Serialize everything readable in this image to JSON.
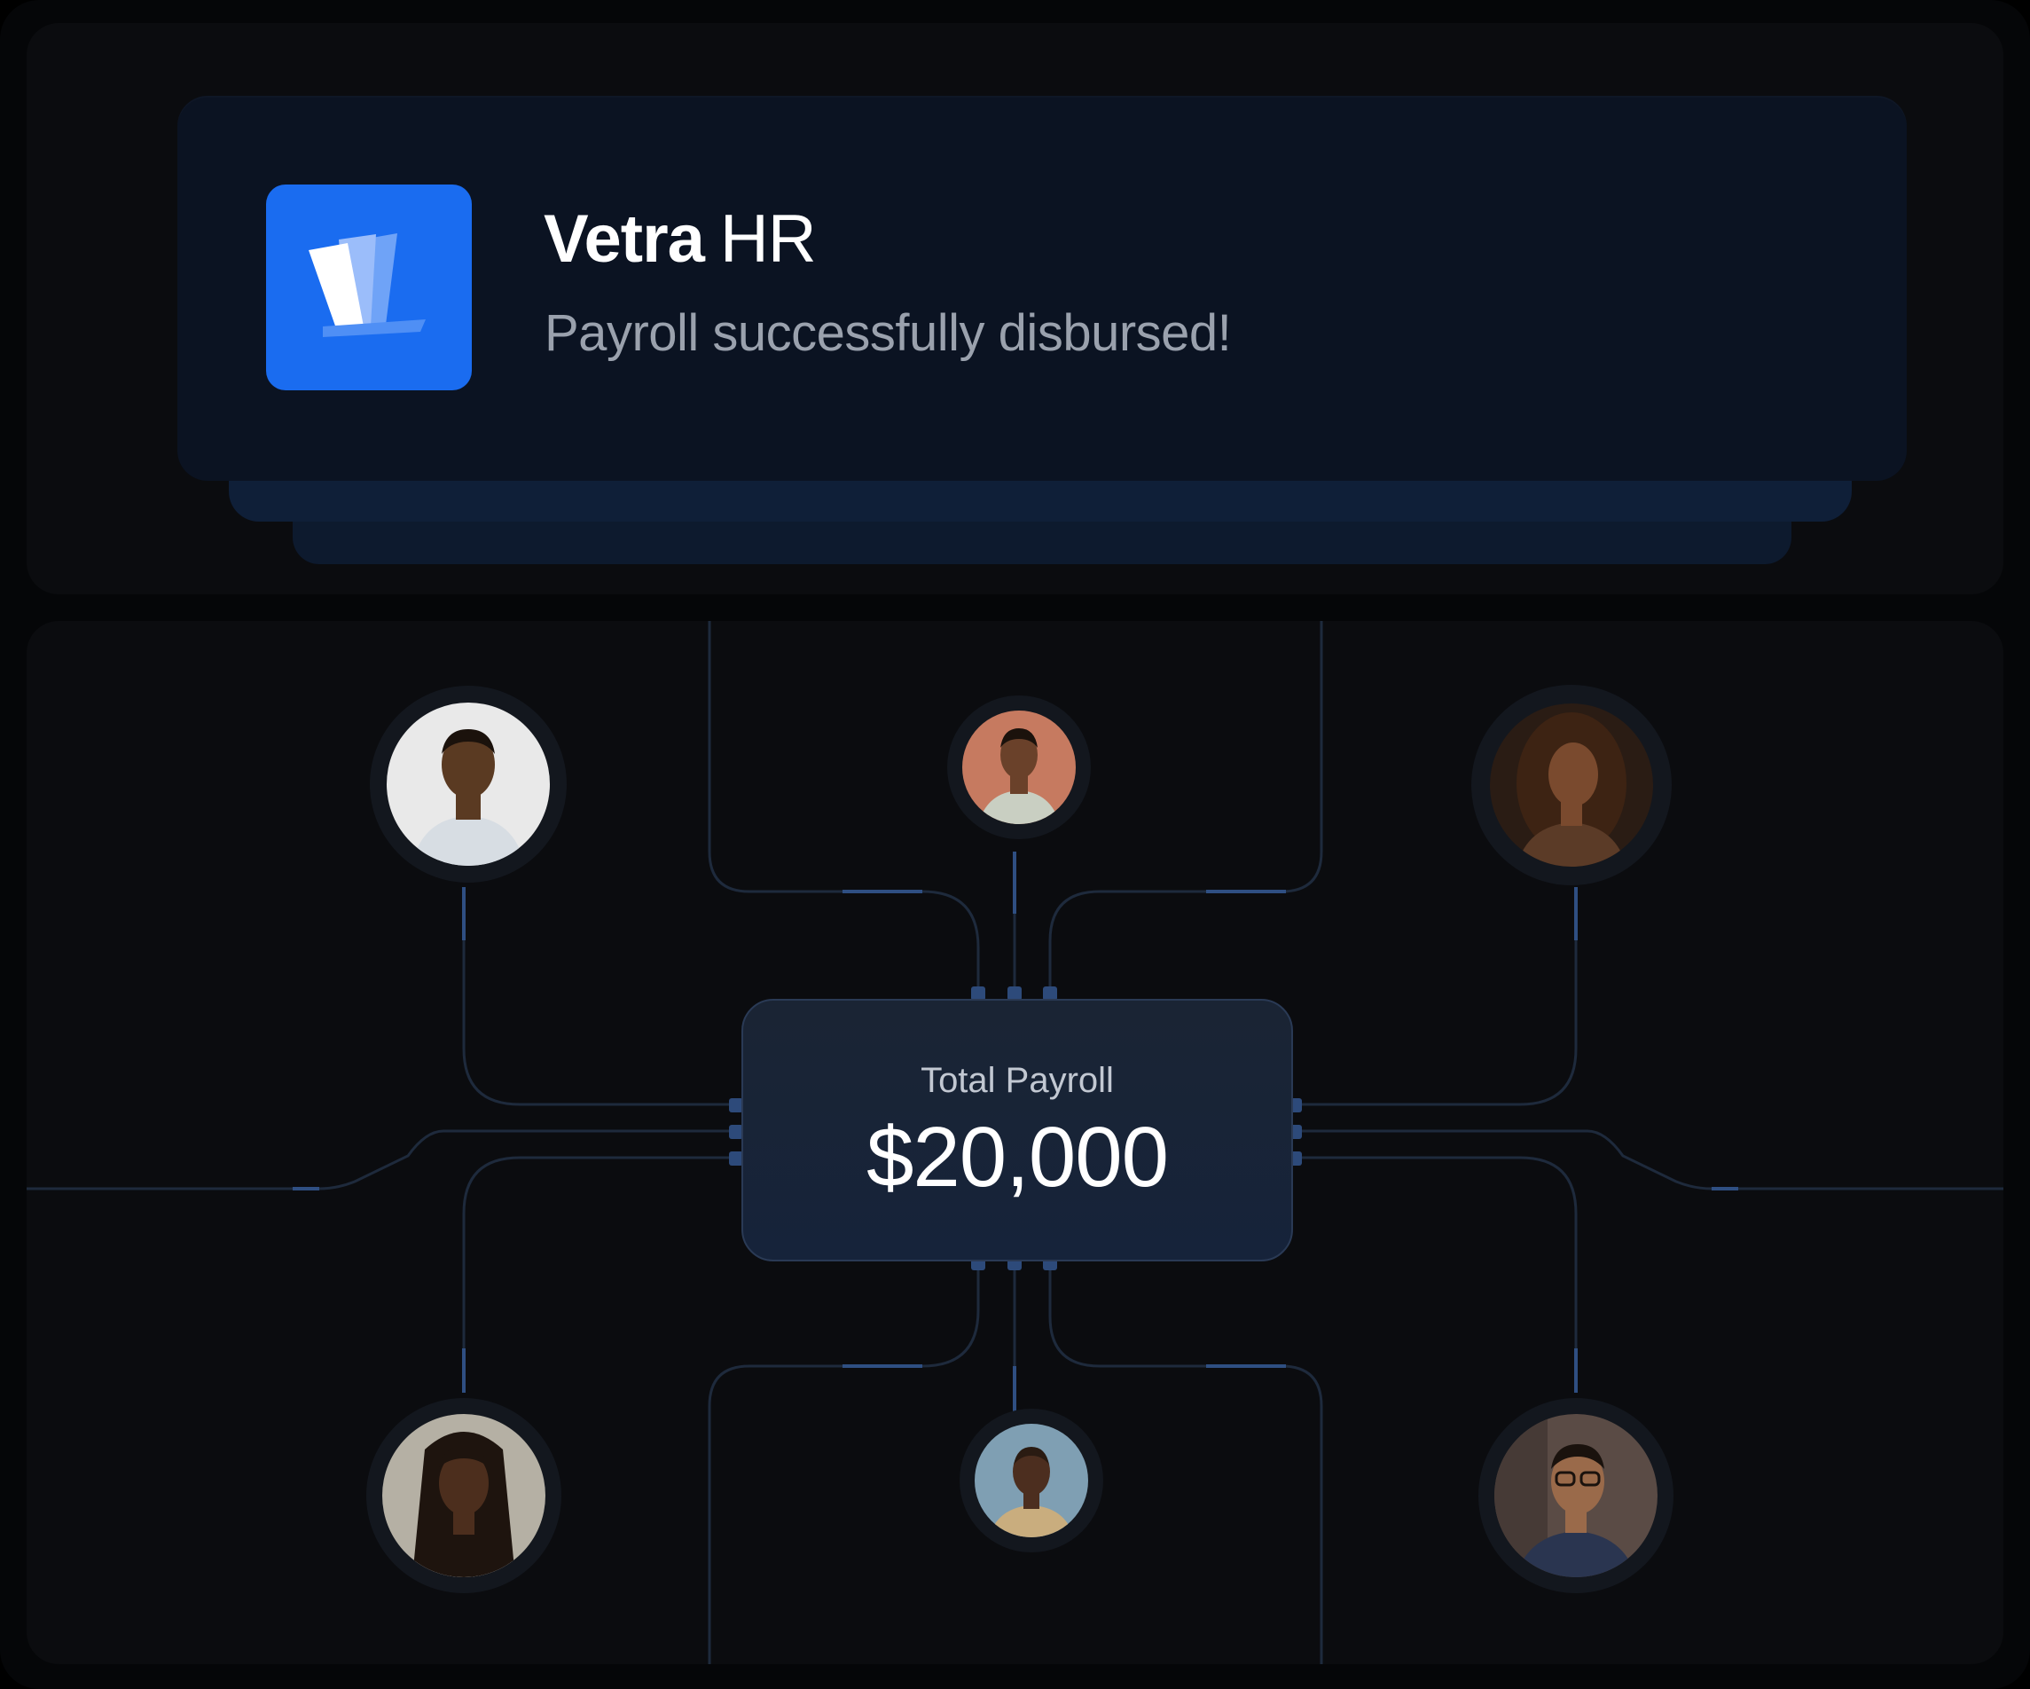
{
  "notification": {
    "app_brand": "Vetra",
    "app_suffix": "HR",
    "message": "Payroll successfully disbursed!",
    "app_icon": "vetra-logo-icon",
    "accent_color": "#1a6cf0"
  },
  "payroll": {
    "label": "Total Payroll",
    "amount": "$20,000"
  },
  "recipients": [
    {
      "id": "employee-1",
      "icon": "person-avatar",
      "bg": "#e9e9e9",
      "skin": "#5a3a22",
      "shirt": "#d7dde3",
      "hair": "#1b120c"
    },
    {
      "id": "employee-2",
      "icon": "person-avatar",
      "bg": "#c67a60",
      "skin": "#6a412a",
      "shirt": "#c9cfc2",
      "hair": "#1b120c"
    },
    {
      "id": "employee-3",
      "icon": "person-avatar",
      "bg": "#2a1c14",
      "skin": "#7a4a2e",
      "shirt": "#5b3b27",
      "hair": "#3d2313"
    },
    {
      "id": "employee-4",
      "icon": "person-avatar",
      "bg": "#b5b0a4",
      "skin": "#4c2e1d",
      "shirt": "#efefef",
      "hair": "#1e140e"
    },
    {
      "id": "employee-5",
      "icon": "person-avatar",
      "bg": "#7f9fb3",
      "skin": "#4c2e1f",
      "shirt": "#c9ad7e",
      "hair": "#2a1b12"
    },
    {
      "id": "employee-6",
      "icon": "person-avatar",
      "bg": "#5a4b45",
      "skin": "#9a6a4a",
      "shirt": "#2a3550",
      "hair": "#1a120d"
    }
  ]
}
